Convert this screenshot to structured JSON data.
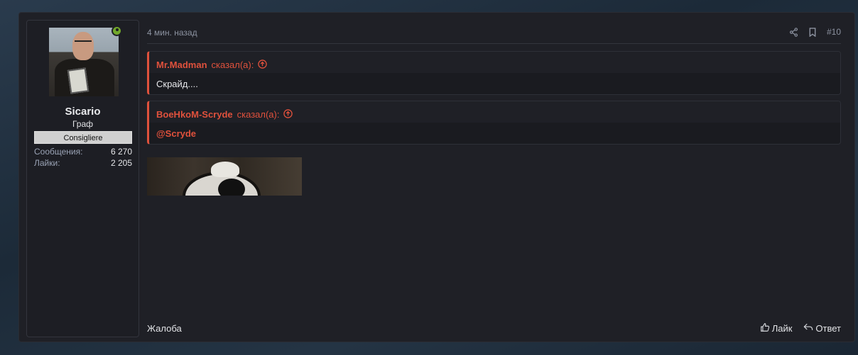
{
  "user": {
    "username": "Sicario",
    "title": "Граф",
    "banner": "Consigliere",
    "stats": [
      {
        "label": "Сообщения:",
        "value": "6 270"
      },
      {
        "label": "Лайки:",
        "value": "2 205"
      }
    ],
    "online": true
  },
  "post": {
    "date": "4 мин. назад",
    "number": "#10",
    "quotes": [
      {
        "author": "Mr.Madman",
        "said": "сказал(а):",
        "body": "Скрайд...."
      },
      {
        "author": "BoeHkoM-Scryde",
        "said": "сказал(а):",
        "body": "@Scryde"
      }
    ],
    "footer": {
      "report": "Жалоба",
      "like": "Лайк",
      "reply": "Ответ"
    }
  },
  "colors": {
    "accent": "#e0513c",
    "online": "#72a82a",
    "background": "#1f2026"
  },
  "icons": [
    "share-icon",
    "bookmark-icon",
    "arrow-up-circle-icon",
    "thumbs-up-icon",
    "reply-icon",
    "user-online-icon"
  ]
}
